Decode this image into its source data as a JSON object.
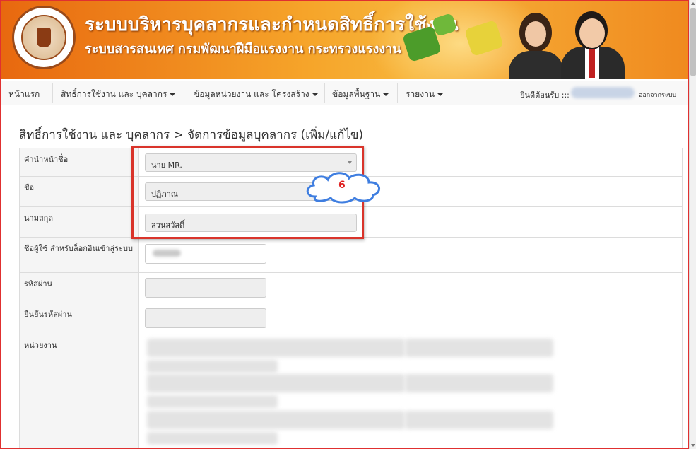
{
  "banner": {
    "title": "ระบบบริหารบุคลากรและกำหนดสิทธิ์การใช้งาน",
    "subtitle": "ระบบสารสนเทศ กรมพัฒนาฝีมือแรงงาน กระทรวงแรงงาน"
  },
  "nav": {
    "home": "หน้าแรก",
    "permissions": "สิทธิ์การใช้งาน และ บุคลากร",
    "units": "ข้อมูลหน่วยงาน และ โครงสร้าง",
    "basic": "ข้อมูลพื้นฐาน",
    "reports": "รายงาน",
    "welcome": "ยินดีต้อนรับ :::",
    "logout": "ออกจากระบบ"
  },
  "page": {
    "title": "สิทธิ์การใช้งาน และ บุคลากร > จัดการข้อมูลบุคลากร (เพิ่ม/แก้ไข)"
  },
  "form": {
    "prefix_label": "คำนำหน้าชื่อ",
    "prefix_value": "นาย MR.",
    "firstname_label": "ชื่อ",
    "firstname_value": "ปฏิภาณ",
    "lastname_label": "นามสกุล",
    "lastname_value": "สวนสวัสดิ์",
    "username_label": "ชื่อผู้ใช้ สำหรับล็อกอินเข้าสู่ระบบ",
    "password_label": "รหัสผ่าน",
    "confirm_label": "ยืนยันรหัสผ่าน",
    "unit_label": "หน่วยงาน"
  },
  "annotation": {
    "step": "6"
  },
  "colors": {
    "banner_orange": "#f08a1f",
    "highlight_red": "#d9342b",
    "cloud_blue": "#3f7ee0"
  }
}
